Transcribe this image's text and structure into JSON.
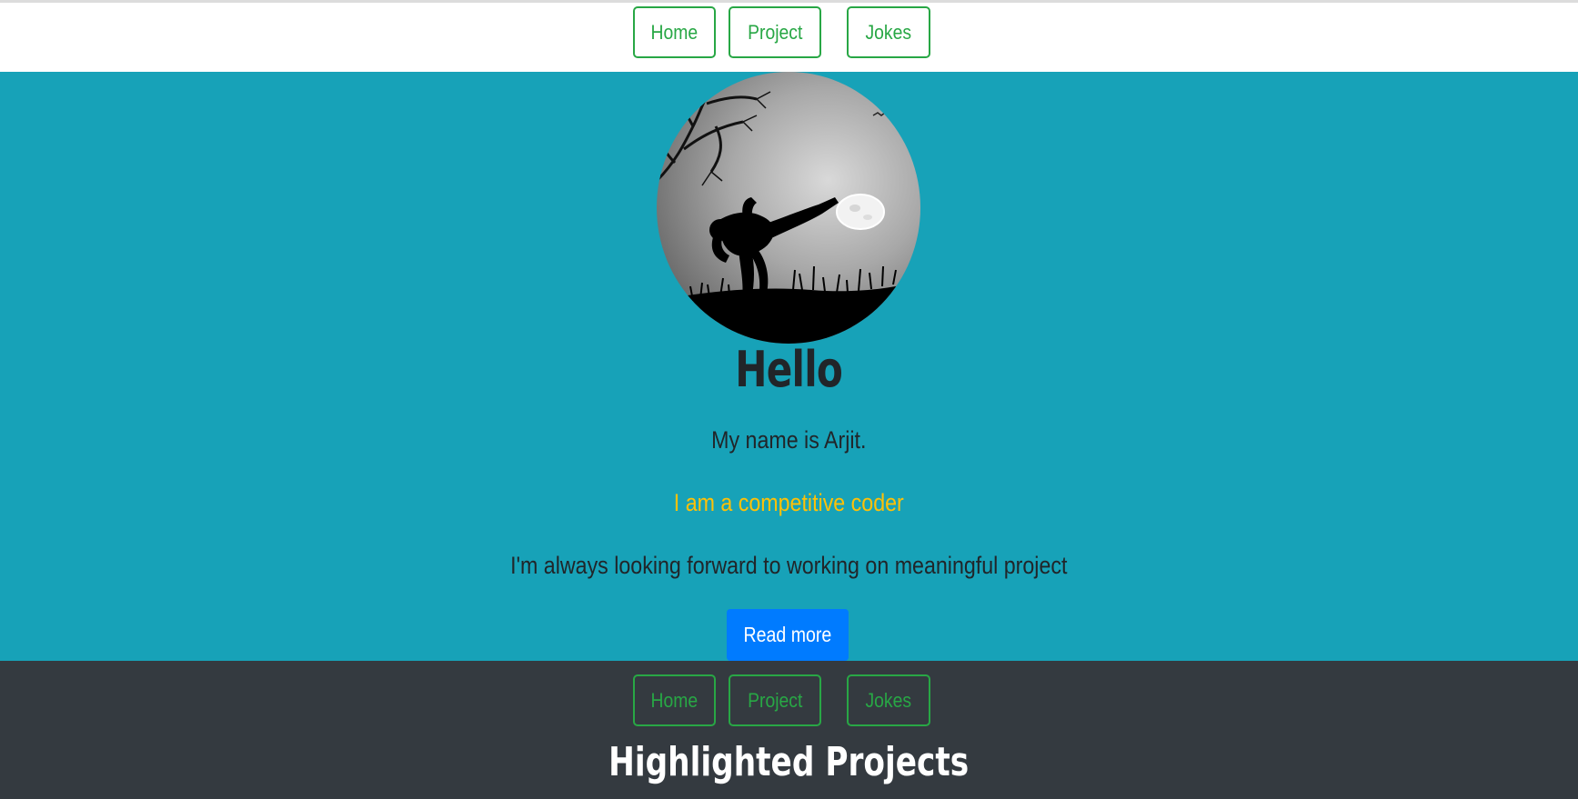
{
  "nav": {
    "items": [
      {
        "label": "Home"
      },
      {
        "label": "Project"
      },
      {
        "label": "Jokes"
      }
    ]
  },
  "hero": {
    "avatar_alt": "karate-kick-silhouette-moon",
    "title": "Hello",
    "name_line": "My name is Arjit.",
    "role_line": "I am a competitive coder",
    "desc_line": "I'm always looking forward to working on meaningful project",
    "read_more_label": "Read more"
  },
  "footer": {
    "nav": {
      "items": [
        {
          "label": "Home"
        },
        {
          "label": "Project"
        },
        {
          "label": "Jokes"
        }
      ]
    },
    "section_title": "Highlighted Projects"
  },
  "colors": {
    "hero_bg": "#17a2b8",
    "nav_outline": "#28a745",
    "role_text": "#ffc107",
    "button_primary": "#007bff",
    "footer_bg": "#343a40"
  }
}
